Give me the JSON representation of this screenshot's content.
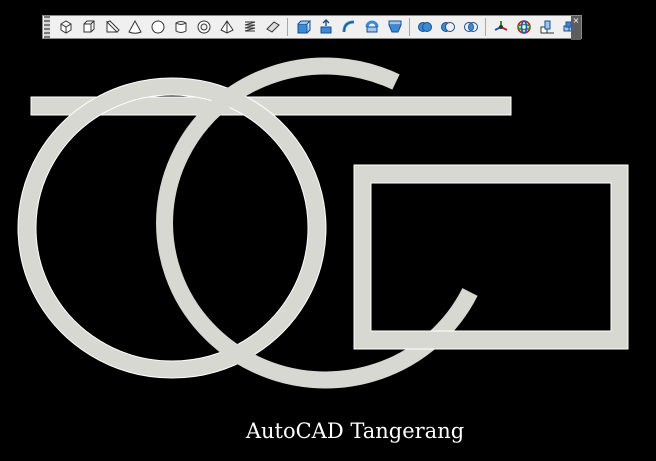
{
  "toolbar": {
    "close_glyph": "×",
    "groups": [
      [
        "box-icon",
        "cube-icon",
        "wedge-icon",
        "cone-icon",
        "sphere-icon",
        "cylinder-icon",
        "torus-icon",
        "pyramid-icon",
        "helix-icon",
        "planar-surface-icon"
      ],
      [
        "extrude-icon",
        "presspull-icon",
        "sweep-icon",
        "revolve-icon",
        "loft-icon"
      ],
      [
        "union-icon",
        "subtract-icon",
        "intersect-icon"
      ],
      [
        "3d-move-icon",
        "3d-rotate-icon",
        "3d-align-icon",
        "3d-array-icon"
      ]
    ]
  },
  "drawing": {
    "stroke_color": "#d8d8d2",
    "outline_color": "#ffffff",
    "background": "#000000"
  },
  "caption": "AutoCAD Tangerang"
}
